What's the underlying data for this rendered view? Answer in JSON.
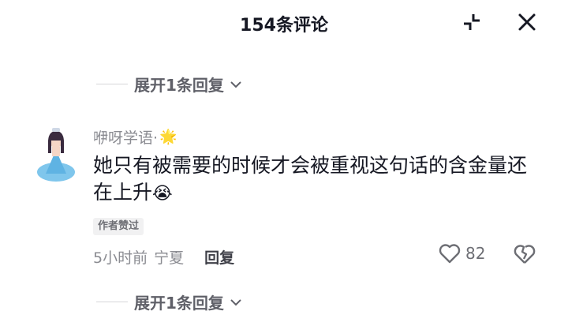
{
  "header": {
    "title": "154条评论"
  },
  "expand_top": {
    "label": "展开1条回复"
  },
  "comment": {
    "username": "咿呀学语·",
    "username_emoji": "🌟",
    "text": "她只有被需要的时候才会被重视这句话的含金量还在上升",
    "inline_emoji": "😭",
    "badge": "作者赞过",
    "time": "5小时前",
    "location": "宁夏",
    "reply_label": "回复",
    "like_count": "82"
  },
  "expand_bottom": {
    "label": "展开1条回复"
  },
  "icons": {
    "collapse": "collapse-icon",
    "close": "close-icon",
    "chevron": "chevron-down-icon",
    "like": "heart-icon",
    "dislike": "broken-heart-icon"
  },
  "colors": {
    "text": "#161823",
    "secondary": "#8a8b91"
  }
}
